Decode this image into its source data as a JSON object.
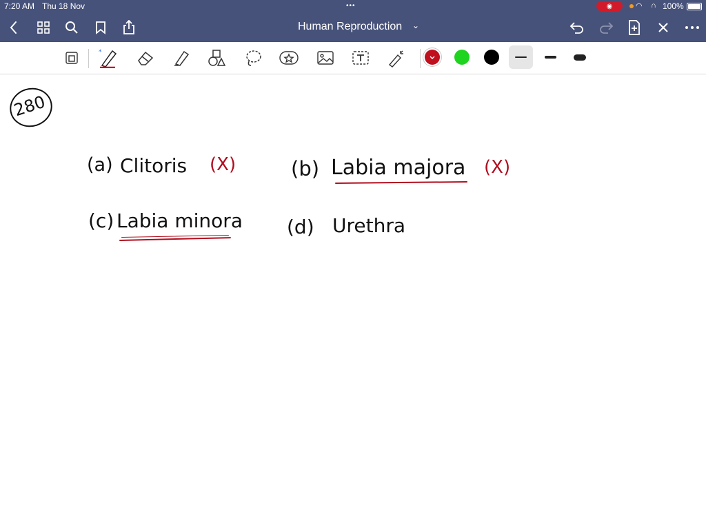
{
  "status_bar": {
    "time": "7:20 AM",
    "date": "Thu 18 Nov",
    "dots": "•••",
    "battery_percent": "100%",
    "recording_icon": "record-icon",
    "wifi_icon": "wifi-icon"
  },
  "nav": {
    "title": "Human Reproduction",
    "caret": "⌄",
    "back_icon": "chevron-left-icon",
    "grid_icon": "grid-icon",
    "search_icon": "search-icon",
    "bookmark_icon": "bookmark-icon",
    "share_icon": "share-icon",
    "undo_icon": "undo-icon",
    "redo_icon": "redo-icon",
    "add_page_icon": "add-page-icon",
    "close_icon": "close-icon",
    "more_icon": "more-icon"
  },
  "toolbar": {
    "tools": [
      "pages-icon",
      "pen-icon",
      "eraser-icon",
      "highlighter-icon",
      "shapes-icon",
      "lasso-icon",
      "sticker-icon",
      "image-icon",
      "text-icon",
      "laser-icon"
    ],
    "colors": {
      "red": "#c0101e",
      "green": "#1ed41e",
      "black": "#000000"
    }
  },
  "note": {
    "question_number": "280",
    "option_a_label": "(a)",
    "option_a_text": "Clitoris",
    "option_a_mark": "(X)",
    "option_b_label": "(b)",
    "option_b_text": "Labia majora",
    "option_b_mark": "(X)",
    "option_c_label": "(c)",
    "option_c_text": "Labia minora",
    "option_d_label": "(d)",
    "option_d_text": "Urethra"
  }
}
